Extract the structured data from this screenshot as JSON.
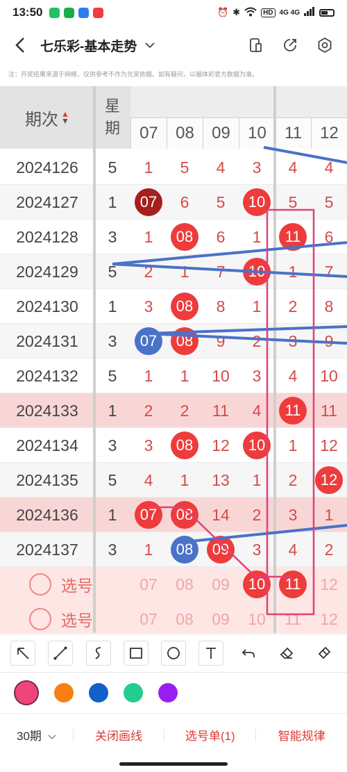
{
  "status_bar": {
    "time": "13:50",
    "app_colors": [
      "#22c063",
      "#1aad4a",
      "#2d7cf0",
      "#ef3c3c"
    ],
    "network": "4G 4G",
    "hd_badge": "HD"
  },
  "nav": {
    "title": "七乐彩-基本走势",
    "dropdown_icon": "chevron-down-icon",
    "icons": [
      "device-icon",
      "share-icon",
      "settings-icon"
    ]
  },
  "notice": "注：开奖结果来源于网络，仅供参考不作为兑奖依据。如有疑问，以福体彩官方数据为准。",
  "table": {
    "header_period": "期次",
    "header_week_top": "星",
    "header_week_bottom": "期",
    "columns": [
      "07",
      "08",
      "09",
      "10",
      "11",
      "12"
    ],
    "rows": [
      {
        "period": "2024126",
        "week": "5",
        "cells": [
          "1",
          "5",
          "4",
          "3",
          "4",
          "4"
        ],
        "balls": {}
      },
      {
        "period": "2024127",
        "week": "1",
        "cells": [
          "07",
          "6",
          "5",
          "10",
          "5",
          "5"
        ],
        "balls": {
          "0": "dark",
          "3": "red"
        }
      },
      {
        "period": "2024128",
        "week": "3",
        "cells": [
          "1",
          "08",
          "6",
          "1",
          "11",
          "6"
        ],
        "balls": {
          "1": "red",
          "4": "red"
        }
      },
      {
        "period": "2024129",
        "week": "5",
        "cells": [
          "2",
          "1",
          "7",
          "10",
          "1",
          "7"
        ],
        "balls": {
          "3": "red"
        }
      },
      {
        "period": "2024130",
        "week": "1",
        "cells": [
          "3",
          "08",
          "8",
          "1",
          "2",
          "8"
        ],
        "balls": {
          "1": "red"
        }
      },
      {
        "period": "2024131",
        "week": "3",
        "cells": [
          "07",
          "08",
          "9",
          "2",
          "3",
          "9"
        ],
        "balls": {
          "0": "blue",
          "1": "red"
        }
      },
      {
        "period": "2024132",
        "week": "5",
        "cells": [
          "1",
          "1",
          "10",
          "3",
          "4",
          "10"
        ],
        "balls": {}
      },
      {
        "period": "2024133",
        "week": "1",
        "cells": [
          "2",
          "2",
          "11",
          "4",
          "11",
          "11"
        ],
        "balls": {
          "4": "red"
        },
        "highlight": true
      },
      {
        "period": "2024134",
        "week": "3",
        "cells": [
          "3",
          "08",
          "12",
          "10",
          "1",
          "12"
        ],
        "balls": {
          "1": "red",
          "3": "red"
        }
      },
      {
        "period": "2024135",
        "week": "5",
        "cells": [
          "4",
          "1",
          "13",
          "1",
          "2",
          "12"
        ],
        "balls": {
          "5": "red"
        }
      },
      {
        "period": "2024136",
        "week": "1",
        "cells": [
          "07",
          "08",
          "14",
          "2",
          "3",
          "1"
        ],
        "balls": {
          "0": "red",
          "1": "red"
        },
        "highlight": true
      },
      {
        "period": "2024137",
        "week": "3",
        "cells": [
          "1",
          "08",
          "09",
          "3",
          "4",
          "2"
        ],
        "balls": {
          "1": "blue",
          "2": "red"
        }
      }
    ],
    "pick_rows": [
      {
        "label": "选号",
        "cells": [
          "07",
          "08",
          "09",
          "10",
          "11",
          "12"
        ],
        "balls": {
          "3": "red",
          "4": "red"
        }
      },
      {
        "label": "选号",
        "cells": [
          "07",
          "08",
          "09",
          "10",
          "11",
          "12"
        ],
        "balls": {}
      }
    ]
  },
  "colors": {
    "ball_red": "#ee3b3b",
    "ball_dark": "#a61e1e",
    "ball_blue": "#4a72c7",
    "line_blue": "#4a72c7",
    "line_pink": "#e0407a",
    "row_highlight": "#f9d6d6",
    "pick_bg": "#fde6e3"
  },
  "toolbar": {
    "tools": [
      "arrow-icon",
      "line-icon",
      "freehand-icon",
      "rectangle-icon",
      "circle-icon",
      "text-icon",
      "undo-icon",
      "eraser-icon",
      "clear-brush-icon"
    ]
  },
  "palette": [
    "#f0457c",
    "#f77f14",
    "#1160c9",
    "#23cc8f",
    "#9a1ef0"
  ],
  "bottom": {
    "periods": "30期",
    "close_draw": "关闭画线",
    "pick_list": "选号单(1)",
    "smart_rules": "智能规律"
  }
}
